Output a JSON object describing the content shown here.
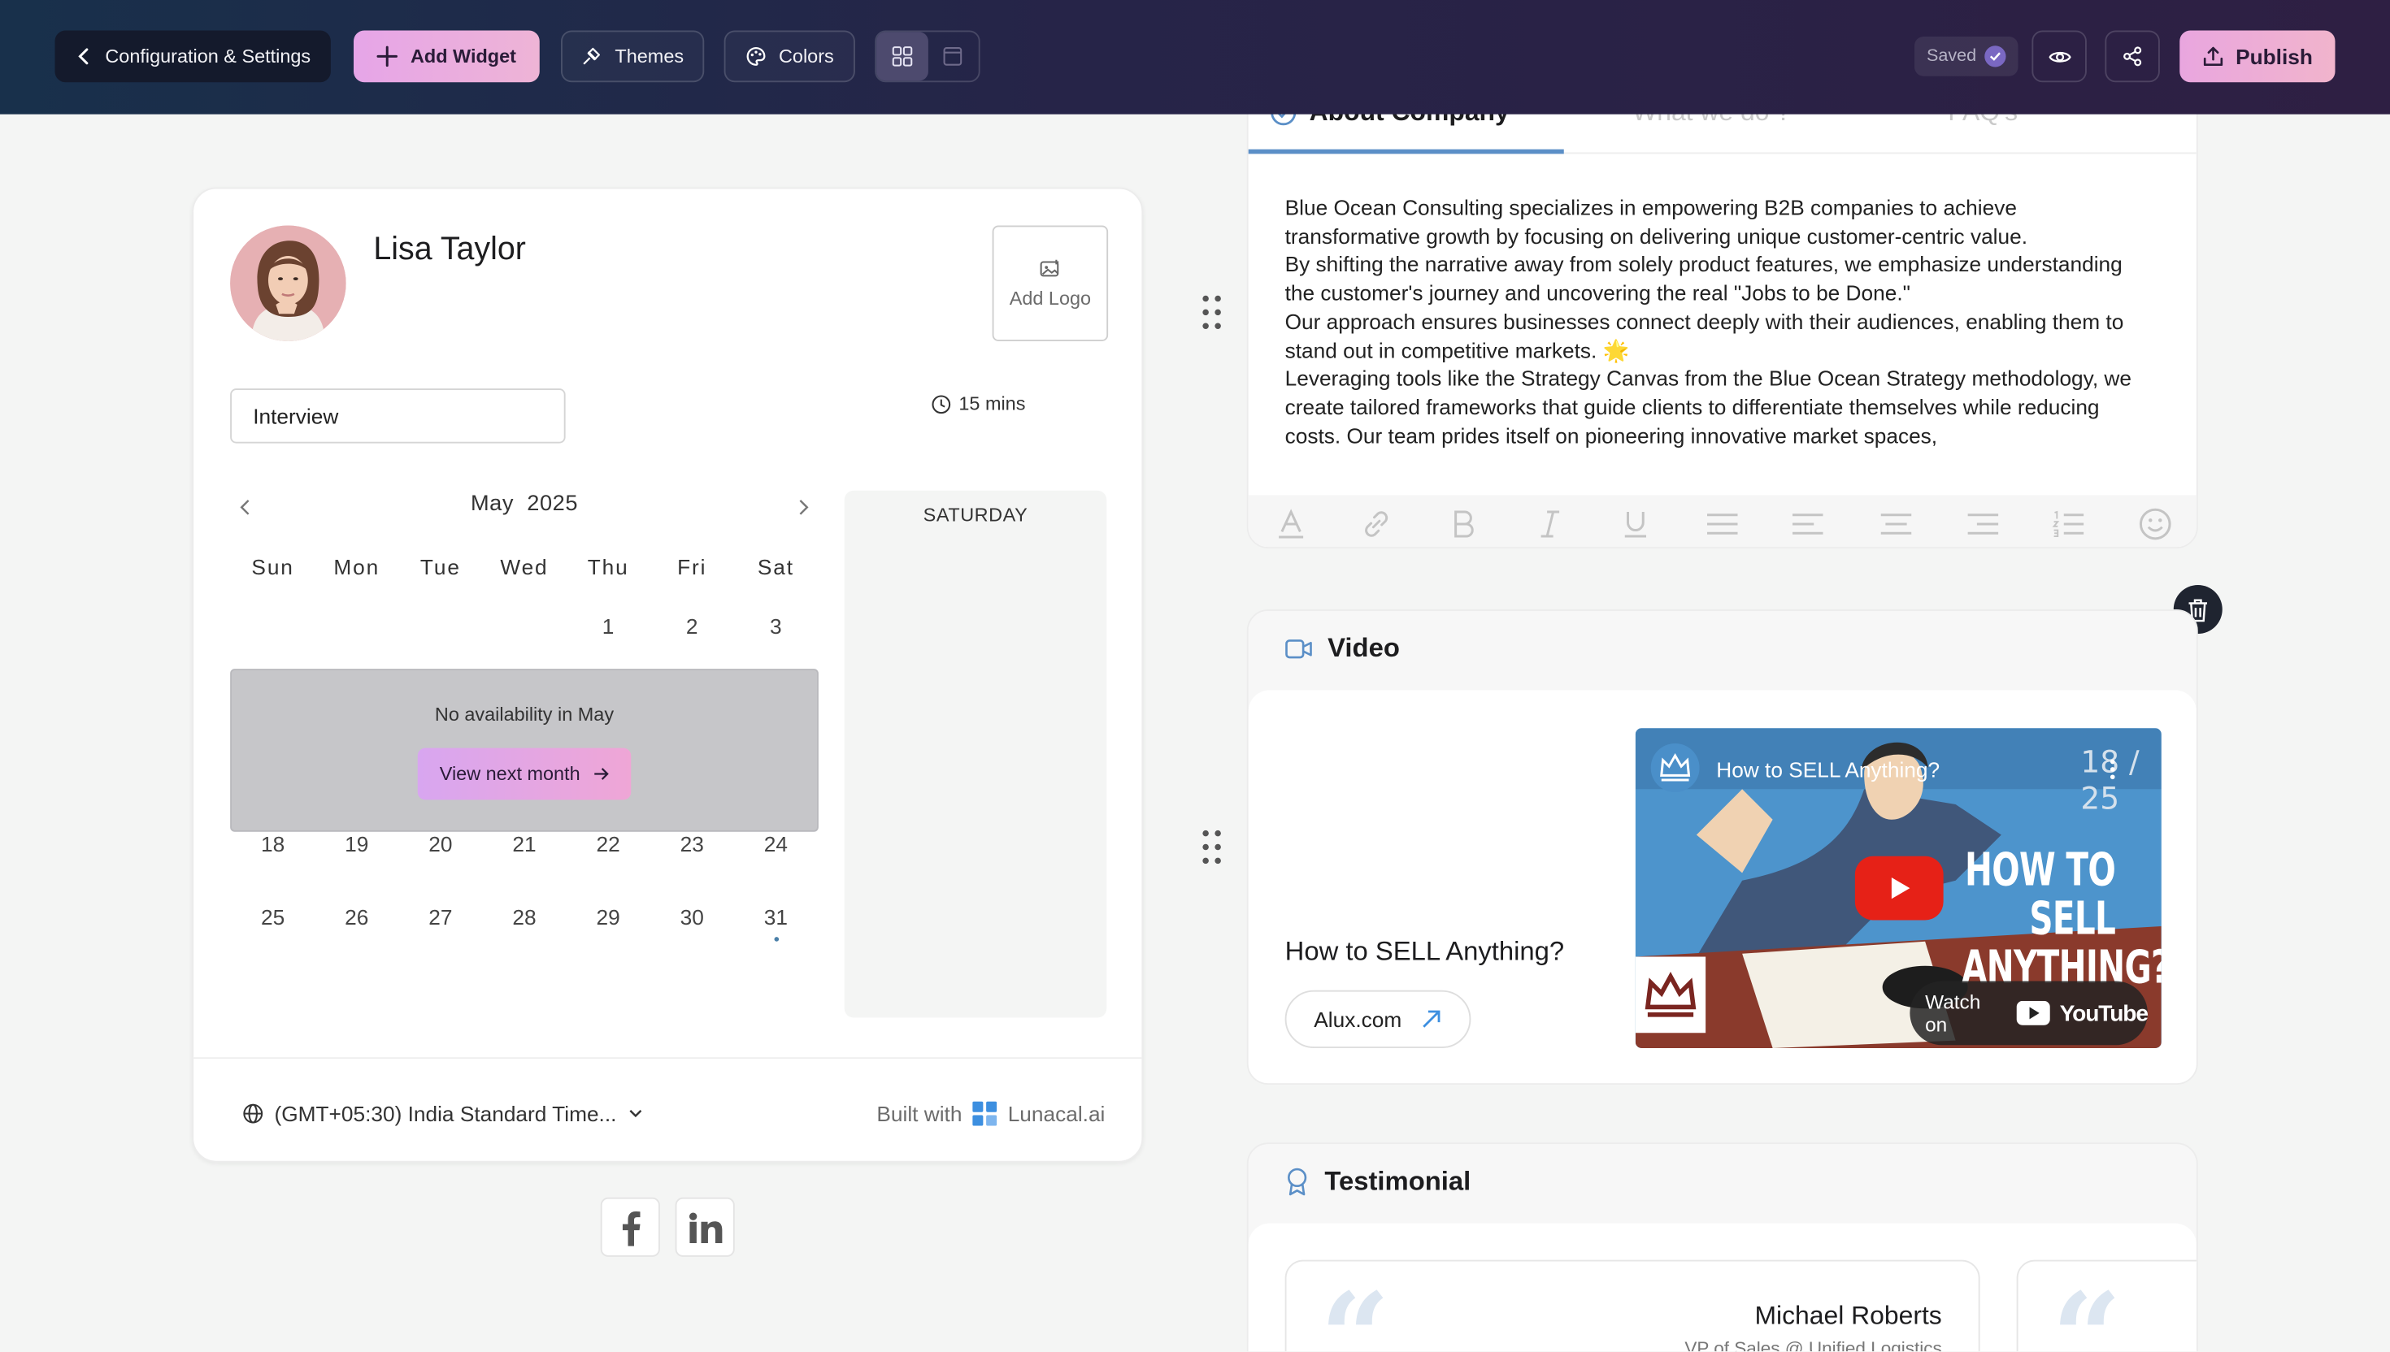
{
  "topbar": {
    "back_label": "Configuration & Settings",
    "add_widget_label": "Add Widget",
    "themes_label": "Themes",
    "colors_label": "Colors",
    "saved_label": "Saved",
    "publish_label": "Publish"
  },
  "booking": {
    "host_name": "Lisa Taylor",
    "add_logo_label": "Add Logo",
    "meeting_type": "Interview",
    "duration": "15 mins",
    "month": "May",
    "year": "2025",
    "weekdays": [
      "Sun",
      "Mon",
      "Tue",
      "Wed",
      "Thu",
      "Fri",
      "Sat"
    ],
    "week1": [
      "1",
      "2",
      "3"
    ],
    "week4": [
      "18",
      "19",
      "20",
      "21",
      "22",
      "23",
      "24"
    ],
    "week5": [
      "25",
      "26",
      "27",
      "28",
      "29",
      "30",
      "31"
    ],
    "no_availability": "No availability in May",
    "view_next_month": "View next month",
    "selected_day_label": "SATURDAY",
    "timezone": "(GMT+05:30) India Standard Time...",
    "built_with": "Built with",
    "brand": "Lunacal.ai"
  },
  "social": [
    {
      "name": "facebook-icon"
    },
    {
      "name": "linkedin-icon"
    }
  ],
  "about": {
    "tabs": [
      "About Company",
      "What we do ?",
      "FAQ's"
    ],
    "active_tab": 0,
    "paragraphs": [
      "Blue Ocean Consulting specializes in empowering B2B companies to achieve transformative growth by focusing on delivering unique customer-centric value.",
      "By shifting the narrative away from solely product features, we emphasize understanding the customer's journey and uncovering the real \"Jobs to be Done.\"",
      "Our approach ensures businesses connect deeply with their audiences, enabling them to stand out in competitive markets. 🌟",
      "Leveraging tools like the Strategy Canvas from the Blue Ocean Strategy methodology, we create tailored frameworks that guide clients to differentiate themselves while reducing costs. Our team prides itself on pioneering innovative market spaces,"
    ],
    "toolbar_icons": [
      "text-color-icon",
      "link-icon",
      "bold-icon",
      "italic-icon",
      "underline-icon",
      "justify-icon",
      "align-left-icon",
      "align-center-icon",
      "align-right-icon",
      "ordered-list-icon",
      "emoji-icon"
    ]
  },
  "video": {
    "heading": "Video",
    "title": "How to SELL Anything?",
    "link_label": "Alux.com",
    "player_title": "How to SELL Anything?",
    "player_counter": "18 / 25",
    "thumbnail_line1": "HOW TO SELL",
    "thumbnail_line2": "ANYTHING?",
    "watch_on": "Watch on",
    "youtube": "YouTube"
  },
  "testimonial": {
    "heading": "Testimonial",
    "name": "Michael Roberts",
    "role": "VP of Sales @ Unified Logistics"
  },
  "colors": {
    "accent_pink": "#e6a5e8",
    "tab_underline": "#5b8fc7",
    "topbar_start": "#18304b",
    "topbar_end": "#2e1f43"
  }
}
